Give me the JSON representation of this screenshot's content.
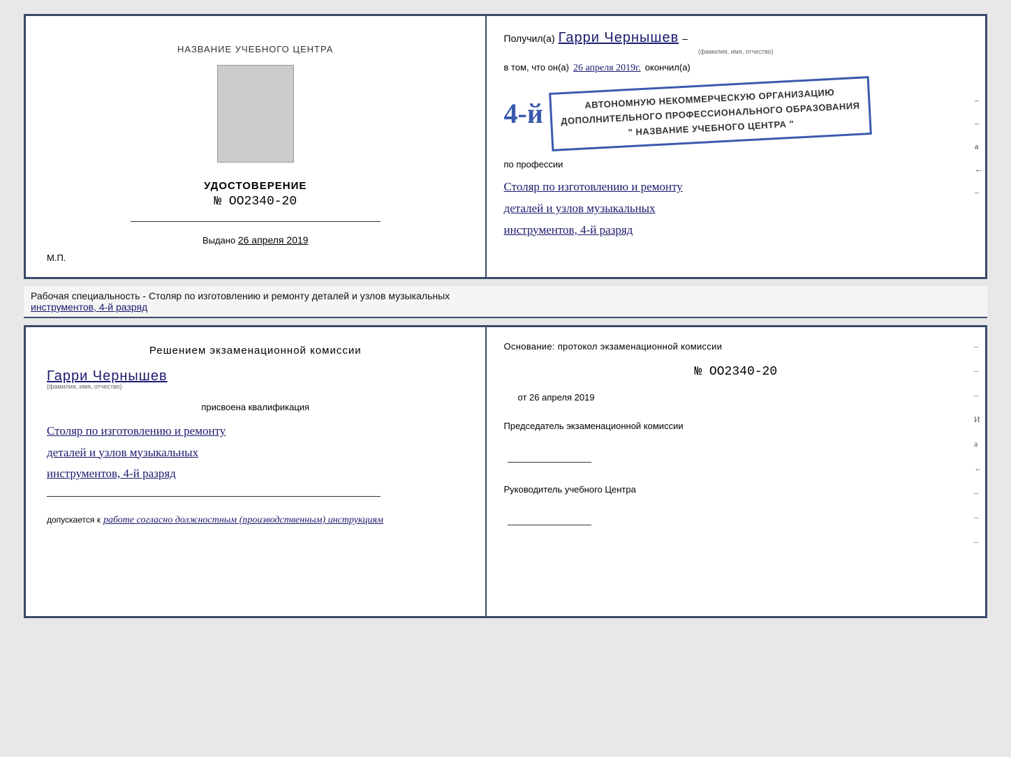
{
  "top_cert": {
    "left": {
      "center_title": "НАЗВАНИЕ УЧЕБНОГО ЦЕНТРА",
      "udostoverenie_label": "УДОСТОВЕРЕНИЕ",
      "number": "№ OO2340-20",
      "vydano_label": "Выдано",
      "vydano_date": "26 апреля 2019",
      "mp_label": "М.П."
    },
    "right": {
      "poluchil_prefix": "Получил(а)",
      "name": "Гарри Чернышев",
      "fio_sub": "(фамилия, имя, отчество)",
      "dash1": "–",
      "vtom_prefix": "в том, что он(а)",
      "date_value": "26 апреля 2019г.",
      "okonchil": "окончил(а)",
      "stamp_line1": "АВТОНОМНУЮ НЕКОММЕРЧЕСКУЮ ОРГАНИЗАЦИЮ",
      "stamp_line2": "ДОПОЛНИТЕЛЬНОГО ПРОФЕССИОНАЛЬНОГО ОБРАЗОВАНИЯ",
      "stamp_line3": "\" НАЗВАНИЕ УЧЕБНОГО ЦЕНТРА \"",
      "stamp_4": "4-й",
      "po_professii": "по профессии",
      "profession_line1": "Столяр по изготовлению и ремонту",
      "profession_line2": "деталей и узлов музыкальных",
      "profession_line3": "инструментов, 4-й разряд"
    },
    "side_marks": [
      "-",
      "–",
      "а",
      "←",
      "–"
    ]
  },
  "description": {
    "text": "Рабочая специальность - Столяр по изготовлению и ремонту деталей и узлов музыкальных",
    "text2": "инструментов, 4-й разряд"
  },
  "bottom_cert": {
    "left": {
      "resheniem_title": "Решением  экзаменационной  комиссии",
      "name": "Гарри Чернышев",
      "fio_sub": "(фамилия, имя, отчество)",
      "prisvoena": "присвоена квалификация",
      "qual_line1": "Столяр по изготовлению и ремонту",
      "qual_line2": "деталей и узлов музыкальных",
      "qual_line3": "инструментов, 4-й разряд",
      "dopuskaetsya_prefix": "допускается к",
      "dopuskaetsya_text": "работе согласно должностным (производственным) инструкциям"
    },
    "right": {
      "osnovanie": "Основание: протокол  экзаменационной  комиссии",
      "number": "№  OO2340-20",
      "ot_prefix": "от",
      "ot_date": "26 апреля 2019",
      "predsedatel_label": "Председатель экзаменационной комиссии",
      "rukovoditel_label": "Руководитель учебного Центра"
    },
    "side_marks": [
      "-",
      "–",
      "–",
      "И",
      "а",
      "←",
      "–",
      "–",
      "–"
    ]
  }
}
